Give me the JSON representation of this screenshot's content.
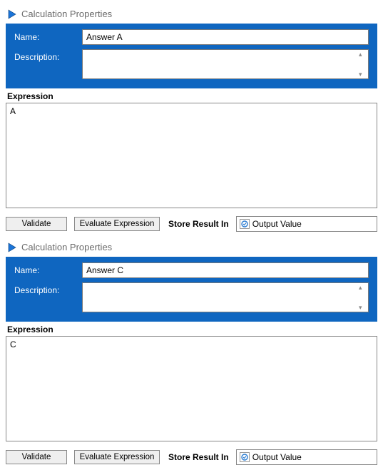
{
  "panels": [
    {
      "header": "Calculation Properties",
      "name_label": "Name:",
      "name_value": "Answer A",
      "description_label": "Description:",
      "description_value": "",
      "expression_label": "Expression",
      "expression_value": "A",
      "validate_btn": "Validate",
      "evaluate_btn": "Evaluate Expression",
      "store_label": "Store Result In",
      "output_value_text": "Output Value"
    },
    {
      "header": "Calculation Properties",
      "name_label": "Name:",
      "name_value": "Answer C",
      "description_label": "Description:",
      "description_value": "",
      "expression_label": "Expression",
      "expression_value": "C",
      "validate_btn": "Validate",
      "evaluate_btn": "Evaluate Expression",
      "store_label": "Store Result In",
      "output_value_text": "Output Value"
    }
  ]
}
